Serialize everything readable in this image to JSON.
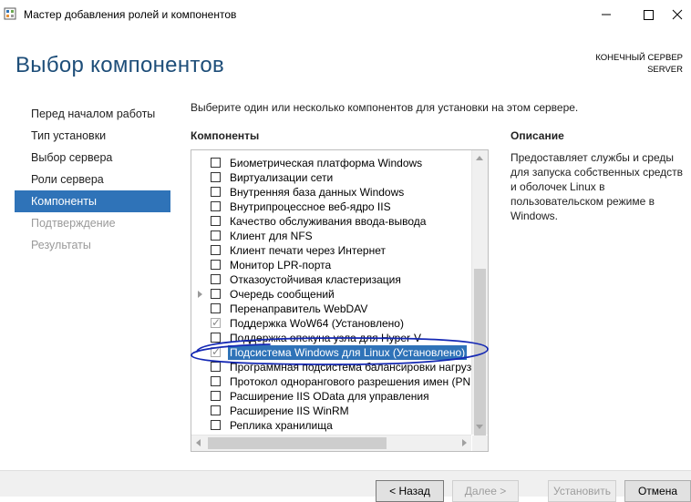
{
  "window": {
    "title": "Мастер добавления ролей и компонентов",
    "minimize_glyph": "—",
    "maximize_glyph": "☐",
    "close_glyph": "✕"
  },
  "header": {
    "title": "Выбор компонентов",
    "server_label": "КОНЕЧНЫЙ СЕРВЕР",
    "server_name": "SERVER"
  },
  "nav": {
    "items": [
      {
        "label": "Перед началом работы",
        "state": "normal"
      },
      {
        "label": "Тип установки",
        "state": "normal"
      },
      {
        "label": "Выбор сервера",
        "state": "normal"
      },
      {
        "label": "Роли сервера",
        "state": "normal"
      },
      {
        "label": "Компоненты",
        "state": "active"
      },
      {
        "label": "Подтверждение",
        "state": "disabled"
      },
      {
        "label": "Результаты",
        "state": "disabled"
      }
    ]
  },
  "main": {
    "instruction": "Выберите один или несколько компонентов для установки на этом сервере.",
    "components_header": "Компоненты",
    "description_header": "Описание",
    "description_text": "Предоставляет службы и среды для запуска собственных средств и оболочек Linux в пользовательском режиме в Windows.",
    "components": [
      {
        "label": "Биометрическая платформа Windows",
        "checked": false,
        "expandable": false
      },
      {
        "label": "Виртуализации сети",
        "checked": false,
        "expandable": false
      },
      {
        "label": "Внутренняя база данных Windows",
        "checked": false,
        "expandable": false
      },
      {
        "label": "Внутрипроцессное веб-ядро IIS",
        "checked": false,
        "expandable": false
      },
      {
        "label": "Качество обслуживания ввода-вывода",
        "checked": false,
        "expandable": false
      },
      {
        "label": "Клиент для NFS",
        "checked": false,
        "expandable": false
      },
      {
        "label": "Клиент печати через Интернет",
        "checked": false,
        "expandable": false
      },
      {
        "label": "Монитор LPR-порта",
        "checked": false,
        "expandable": false
      },
      {
        "label": "Отказоустойчивая кластеризация",
        "checked": false,
        "expandable": false
      },
      {
        "label": "Очередь сообщений",
        "checked": false,
        "expandable": true
      },
      {
        "label": "Перенаправитель WebDAV",
        "checked": false,
        "expandable": false
      },
      {
        "label": "Поддержка WoW64 (Установлено)",
        "checked": true,
        "expandable": false
      },
      {
        "label": "Поддержка опекуна узла для Hyper-V",
        "checked": false,
        "expandable": false
      },
      {
        "label": "Подсистема Windows для Linux (Установлено)",
        "checked": true,
        "expandable": false,
        "selected": true
      },
      {
        "label": "Программная подсистема балансировки нагруз",
        "checked": false,
        "expandable": false
      },
      {
        "label": "Протокол однорангового разрешения имен (PN",
        "checked": false,
        "expandable": false
      },
      {
        "label": "Расширение IIS OData для управления",
        "checked": false,
        "expandable": false
      },
      {
        "label": "Расширение IIS WinRM",
        "checked": false,
        "expandable": false
      },
      {
        "label": "Реплика хранилища",
        "checked": false,
        "expandable": false
      }
    ]
  },
  "buttons": {
    "back": "< Назад",
    "next": "Далее >",
    "install": "Установить",
    "cancel": "Отмена"
  },
  "colors": {
    "accent": "#2f73b8",
    "header_title": "#1e4e79",
    "annotation": "#1428b4"
  }
}
